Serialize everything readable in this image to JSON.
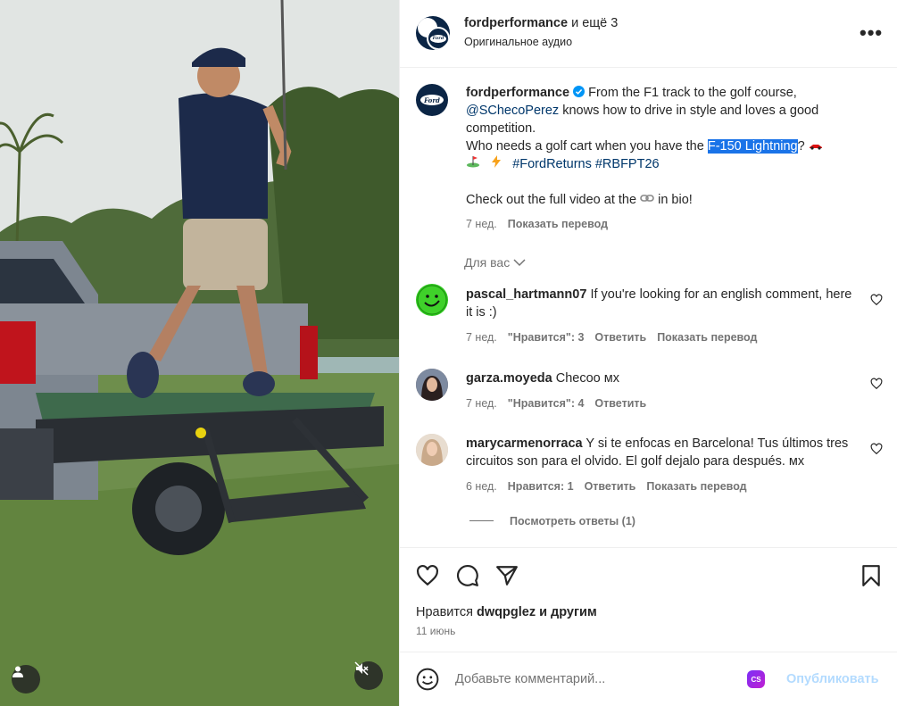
{
  "post": {
    "header_title": "fordperformance",
    "header_others": "и ещё 3",
    "audio": "Оригинальное аудио",
    "more_icon": "more-horizontal-icon"
  },
  "caption": {
    "username": "fordperformance",
    "line1": "From the F1 track to the golf course,",
    "mention": "@SChecoPerez",
    "line2": " knows how to drive in style and loves a good competition.",
    "line3_pre": "Who needs a golf cart when you have the ",
    "line3_highlight": "F-150 Lightning",
    "line3_post": "?",
    "hashtags": "#FordReturns #RBFPT26",
    "line4_pre": "Check out the full video at the",
    "line4_post": " in bio!",
    "age": "7 нед.",
    "translate": "Показать перевод"
  },
  "for_you": "Для вас",
  "comments": [
    {
      "username": "pascal_hartmann07",
      "text": "If you're looking for an english comment, here it is :)",
      "age": "7 нед.",
      "likes": "\"Нравится\": 3",
      "reply": "Ответить",
      "translate": "Показать перевод"
    },
    {
      "username": "garza.moyeda",
      "text": "Checoo мх",
      "age": "7 нед.",
      "likes": "\"Нравится\": 4",
      "reply": "Ответить"
    },
    {
      "username": "marycarmenorraca",
      "text": "Y si te enfocas en Barcelona! Tus últimos tres circuitos son para el olvido. El golf dejalo para después. мх",
      "age": "6 нед.",
      "likes": "Нравится: 1",
      "reply": "Ответить",
      "translate": "Показать перевод",
      "view_replies": "Посмотреть ответы (1)"
    }
  ],
  "likes_line": {
    "prefix": "Нравится",
    "user": "dwqpglez",
    "suffix": "и другим"
  },
  "post_date": "11 июнь",
  "comment_bar": {
    "placeholder": "Добавьте комментарий...",
    "publish": "Опубликовать",
    "badge": "CS"
  },
  "colors": {
    "link": "#00376b",
    "muted": "#737373",
    "publish_disabled": "#b3dbff",
    "highlight": "#1a73e8"
  }
}
